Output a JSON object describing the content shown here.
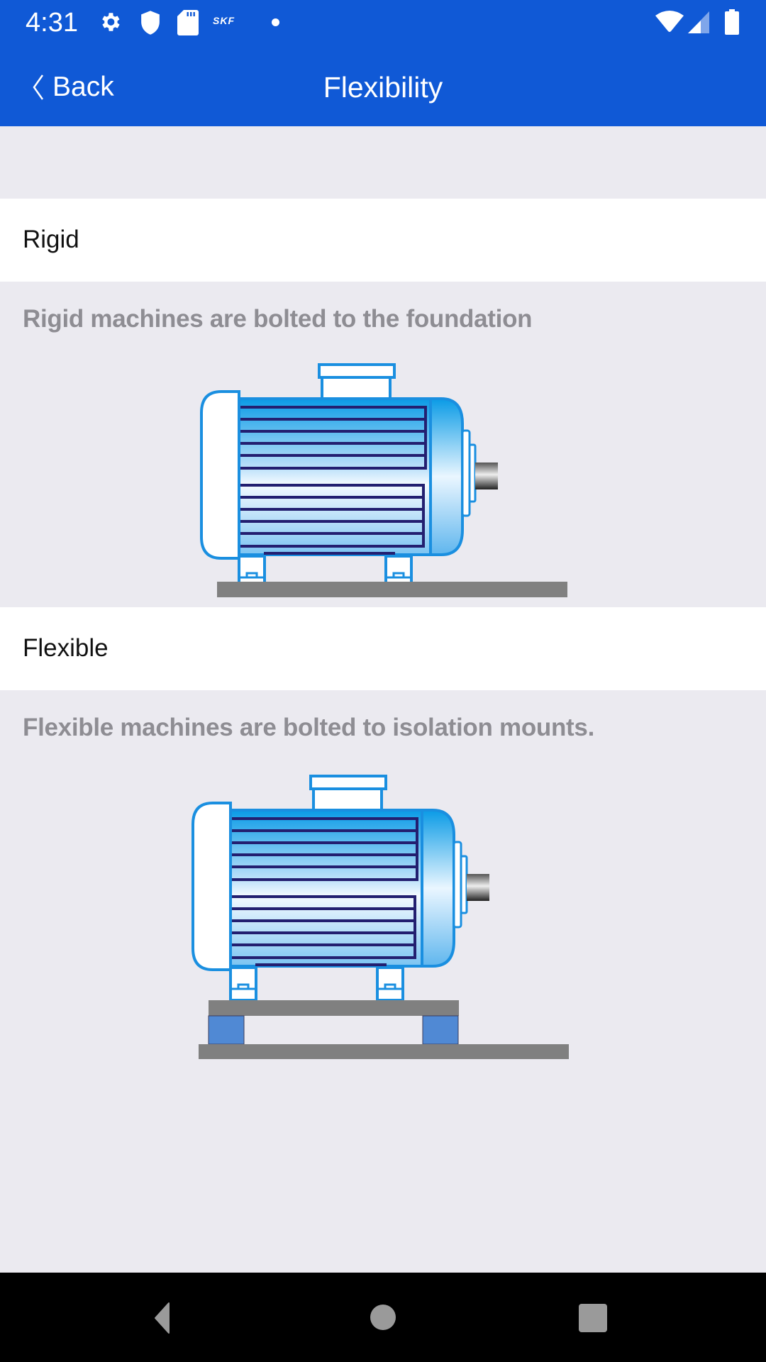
{
  "status_bar": {
    "time": "4:31",
    "left_icons": [
      "gear-icon",
      "shield-icon",
      "sd-card-icon",
      "skf-logo-icon",
      "notification-dot-icon"
    ],
    "skf_label": "SKF",
    "right_icons": [
      "wifi-icon",
      "cell-signal-icon",
      "battery-icon"
    ]
  },
  "header": {
    "back_label": "Back",
    "title": "Flexibility"
  },
  "sections": [
    {
      "heading": "Rigid",
      "description": "Rigid machines are bolted to the foundation",
      "illustration": "motor-rigid-foundation-illustration"
    },
    {
      "heading": "Flexible",
      "description": "Flexible machines are bolted to isolation mounts.",
      "illustration": "motor-isolation-mounts-illustration"
    }
  ],
  "colors": {
    "app_bar": "#1059D6",
    "background": "#EBEAF0",
    "description_text": "#8E8D93",
    "motor_outline": "#1A8FE0",
    "fin_lines": "#231F70",
    "foundation": "#808080",
    "isolation_mount": "#5089D4"
  },
  "system_nav": {
    "buttons": [
      "back-triangle-icon",
      "home-circle-icon",
      "recents-square-icon"
    ]
  }
}
